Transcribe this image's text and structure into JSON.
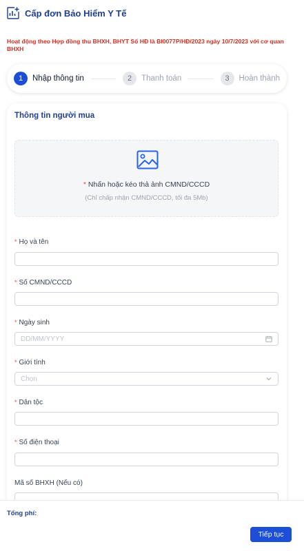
{
  "header": {
    "title": "Cấp đơn Bảo Hiểm Y Tế",
    "icon": "chart-add-icon"
  },
  "notice": "Hoạt động theo Hợp đồng thu BHXH, BHYT Số HĐ là BI0077P/HĐ/2023 ngày 10/7/2023 với cơ quan BHXH",
  "stepper": {
    "steps": [
      {
        "num": "1",
        "label": "Nhập thông tin",
        "active": true
      },
      {
        "num": "2",
        "label": "Thanh toán",
        "active": false
      },
      {
        "num": "3",
        "label": "Hoàn thành",
        "active": false
      }
    ]
  },
  "form": {
    "section_title": "Thông tin người mua",
    "upload": {
      "icon": "image-icon",
      "required_mark": "*",
      "main_text": "Nhấn hoặc kéo thả ảnh CMND/CCCD",
      "sub_text": "(Chỉ chấp nhận CMND/CCCD, tối đa 5Mb)"
    },
    "fields": {
      "full_name": {
        "label": "Họ và tên",
        "required": "*",
        "value": ""
      },
      "id_number": {
        "label": "Số CMND/CCCD",
        "required": "*",
        "value": ""
      },
      "dob": {
        "label": "Ngày sinh",
        "required": "*",
        "placeholder": "DD/MM/YYYY"
      },
      "gender": {
        "label": "Giới tính",
        "required": "*",
        "placeholder": "Chọn"
      },
      "ethnicity": {
        "label": "Dân tộc",
        "required": "*",
        "value": ""
      },
      "phone": {
        "label": "Số điện thoại",
        "required": "*",
        "value": ""
      },
      "social_insurance": {
        "label": "Mã số BHXH (Nếu có)",
        "value": ""
      }
    }
  },
  "footer": {
    "total_label": "Tổng phí:",
    "next_button": "Tiếp tục"
  },
  "colors": {
    "primary": "#1d4ed8",
    "title": "#1f3f8f",
    "notice": "#d92d20",
    "required": "#ef4444"
  }
}
